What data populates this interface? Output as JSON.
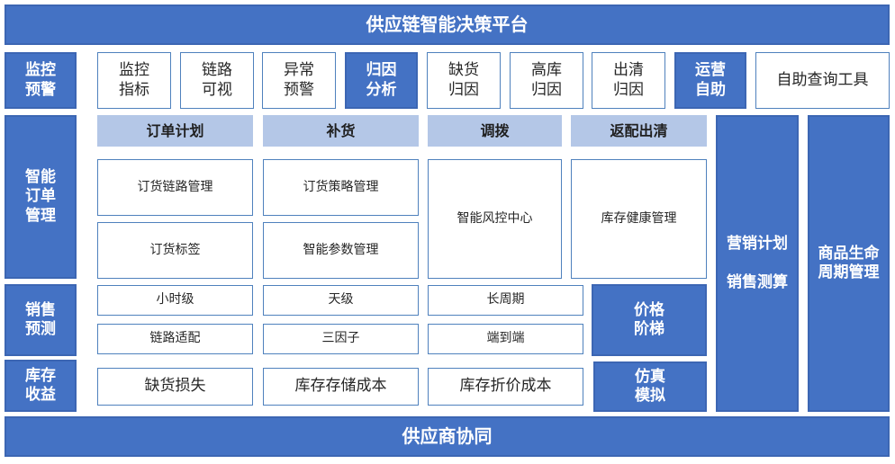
{
  "title": "供应链智能决策平台",
  "footer": "供应商协同",
  "colors": {
    "primary": "#4472c4",
    "light": "#b4c7e7",
    "border": "#4f81bd"
  },
  "rows": {
    "monitor": "监控\n预警",
    "order": "智能\n订单\n管理",
    "forecast": "销售\n预测",
    "inventory": "库存\n收益"
  },
  "monitor_items": {
    "indicator": "监控\n指标",
    "chain_visible": "链路\n可视",
    "anomaly": "异常\n预警",
    "attribution": "归因\n分析",
    "stockout_cause": "缺货\n归因",
    "high_stock_cause": "高库\n归因",
    "clearance_cause": "出清\n归因",
    "ops_self": "运营\n自助",
    "self_query": "自助查询工具"
  },
  "columns": {
    "order_plan": "订单计划",
    "replenish": "补货",
    "transfer": "调拨",
    "return_clear": "返配出清"
  },
  "order_items": {
    "chain_mgmt": "订货链路管理",
    "order_tag": "订货标签",
    "strategy_mgmt": "订货策略管理",
    "param_mgmt": "智能参数管理",
    "risk_center": "智能风控中心",
    "health_mgmt": "库存健康管理"
  },
  "forecast_items": {
    "hourly": "小时级",
    "daily": "天级",
    "long_period": "长周期",
    "chain_adapt": "链路适配",
    "three_factor": "三因子",
    "end_to_end": "端到端",
    "price_ladder": "价格\n阶梯"
  },
  "inventory_items": {
    "stockout_loss": "缺货损失",
    "storage_cost": "库存存储成本",
    "discount_cost": "库存折价成本",
    "simulation": "仿真\n模拟"
  },
  "side": {
    "marketing_plan": "营销计划",
    "sales_calc": "销售测算",
    "lifecycle": "商品生命\n周期管理"
  }
}
